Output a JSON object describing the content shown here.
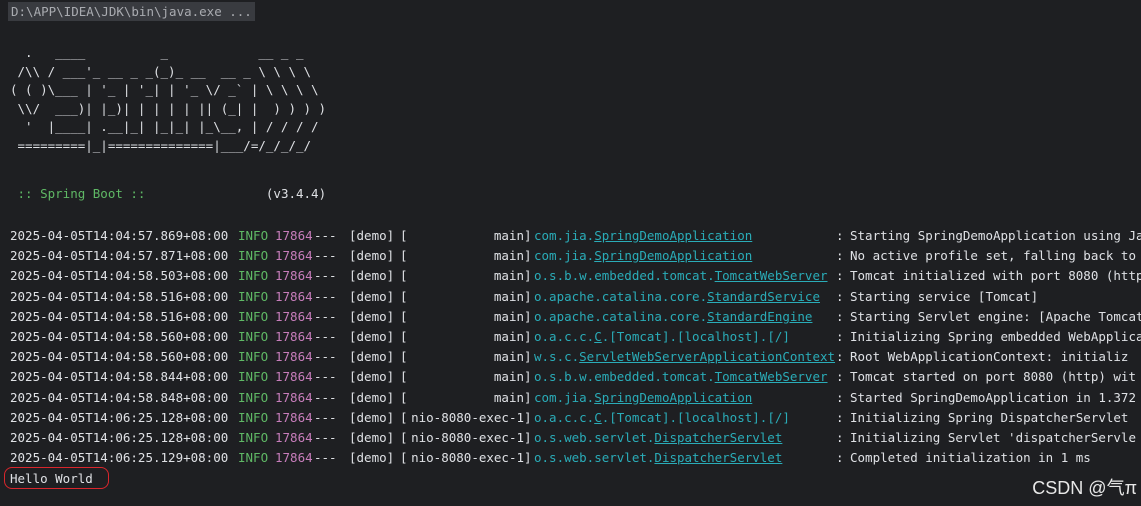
{
  "console": {
    "command": "D:\\APP\\IDEA\\JDK\\bin\\java.exe ...",
    "banner": "  .   ____          _            __ _ _\n /\\\\ / ___'_ __ _ _(_)_ __  __ _ \\ \\ \\ \\\n( ( )\\___ | '_ | '_| | '_ \\/ _` | \\ \\ \\ \\\n \\\\/  ___)| |_)| | | | | || (_| |  ) ) ) )\n  '  |____| .__|_| |_|_| |_\\__, | / / / /\n =========|_|==============|___/=/_/_/_/",
    "boot_label": " :: Spring Boot ::",
    "boot_version": "(v3.4.4)",
    "logs": [
      {
        "ts": "2025-04-05T14:04:57.869+08:00",
        "level": "INFO",
        "pid": "17864",
        "sep": "---",
        "app": "[demo]",
        "thread": "main",
        "logger_prefix": "com.jia.",
        "logger_class": "SpringDemoApplication",
        "message": "Starting SpringDemoApplication using Ja"
      },
      {
        "ts": "2025-04-05T14:04:57.871+08:00",
        "level": "INFO",
        "pid": "17864",
        "sep": "---",
        "app": "[demo]",
        "thread": "main",
        "logger_prefix": "com.jia.",
        "logger_class": "SpringDemoApplication",
        "message": "No active profile set, falling back to"
      },
      {
        "ts": "2025-04-05T14:04:58.503+08:00",
        "level": "INFO",
        "pid": "17864",
        "sep": "---",
        "app": "[demo]",
        "thread": "main",
        "logger_prefix": "o.s.b.w.embedded.tomcat.",
        "logger_class": "TomcatWebServer",
        "message": "Tomcat initialized with port 8080 (http"
      },
      {
        "ts": "2025-04-05T14:04:58.516+08:00",
        "level": "INFO",
        "pid": "17864",
        "sep": "---",
        "app": "[demo]",
        "thread": "main",
        "logger_prefix": "o.apache.catalina.core.",
        "logger_class": "StandardService",
        "message": "Starting service [Tomcat]"
      },
      {
        "ts": "2025-04-05T14:04:58.516+08:00",
        "level": "INFO",
        "pid": "17864",
        "sep": "---",
        "app": "[demo]",
        "thread": "main",
        "logger_prefix": "o.apache.catalina.core.",
        "logger_class": "StandardEngine",
        "message": "Starting Servlet engine: [Apache Tomcat"
      },
      {
        "ts": "2025-04-05T14:04:58.560+08:00",
        "level": "INFO",
        "pid": "17864",
        "sep": "---",
        "app": "[demo]",
        "thread": "main",
        "logger_prefix": "o.a.c.c.",
        "logger_class": "C",
        "logger_suffix": ".[Tomcat].[localhost].[/]",
        "message": "Initializing Spring embedded WebApplica"
      },
      {
        "ts": "2025-04-05T14:04:58.560+08:00",
        "level": "INFO",
        "pid": "17864",
        "sep": "---",
        "app": "[demo]",
        "thread": "main",
        "logger_prefix": "w.s.c.",
        "logger_class": "ServletWebServerApplicationContext",
        "message": "Root WebApplicationContext: initializ"
      },
      {
        "ts": "2025-04-05T14:04:58.844+08:00",
        "level": "INFO",
        "pid": "17864",
        "sep": "---",
        "app": "[demo]",
        "thread": "main",
        "logger_prefix": "o.s.b.w.embedded.tomcat.",
        "logger_class": "TomcatWebServer",
        "message": "Tomcat started on port 8080 (http) wit"
      },
      {
        "ts": "2025-04-05T14:04:58.848+08:00",
        "level": "INFO",
        "pid": "17864",
        "sep": "---",
        "app": "[demo]",
        "thread": "main",
        "logger_prefix": "com.jia.",
        "logger_class": "SpringDemoApplication",
        "message": "Started SpringDemoApplication in 1.372"
      },
      {
        "ts": "2025-04-05T14:06:25.128+08:00",
        "level": "INFO",
        "pid": "17864",
        "sep": "---",
        "app": "[demo]",
        "thread": "nio-8080-exec-1",
        "logger_prefix": "o.a.c.c.",
        "logger_class": "C",
        "logger_suffix": ".[Tomcat].[localhost].[/]",
        "message": "Initializing Spring DispatcherServlet"
      },
      {
        "ts": "2025-04-05T14:06:25.128+08:00",
        "level": "INFO",
        "pid": "17864",
        "sep": "---",
        "app": "[demo]",
        "thread": "nio-8080-exec-1",
        "logger_prefix": "o.s.web.servlet.",
        "logger_class": "DispatcherServlet",
        "message": "Initializing Servlet 'dispatcherServle"
      },
      {
        "ts": "2025-04-05T14:06:25.129+08:00",
        "level": "INFO",
        "pid": "17864",
        "sep": "---",
        "app": "[demo]",
        "thread": "nio-8080-exec-1",
        "logger_prefix": "o.s.web.servlet.",
        "logger_class": "DispatcherServlet",
        "message": "Completed initialization in 1 ms"
      }
    ],
    "output": "Hello World"
  },
  "watermark": "CSDN @气π",
  "colors": {
    "background": "#1e1f22",
    "info": "#5fb865",
    "pid": "#c77dbb",
    "logger": "#2aacb8",
    "highlight_border": "#d9262c"
  }
}
